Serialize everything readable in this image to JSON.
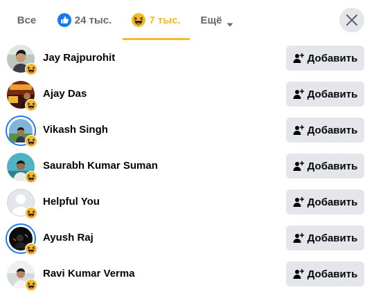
{
  "tabs": {
    "all_label": "Все",
    "like_count": "24 тыс.",
    "haha_count": "7 тыс.",
    "more_label": "Ещё"
  },
  "colors": {
    "accent_haha": "#f7b928",
    "like_blue": "#1877f2",
    "button_bg": "#e4e6eb",
    "text_primary": "#050505",
    "text_secondary": "#65676b"
  },
  "icons": {
    "like": "like-reaction-icon",
    "haha": "haha-reaction-icon",
    "more_caret": "caret-down-icon",
    "close": "close-icon",
    "add_friend": "add-friend-icon"
  },
  "people": [
    {
      "name": "Jay Rajpurohit",
      "add_label": "Добавить"
    },
    {
      "name": "Ajay Das",
      "add_label": "Добавить"
    },
    {
      "name": "Vikash Singh",
      "add_label": "Добавить"
    },
    {
      "name": "Saurabh Kumar Suman",
      "add_label": "Добавить"
    },
    {
      "name": "Helpful You",
      "add_label": "Добавить"
    },
    {
      "name": "Ayush Raj",
      "add_label": "Добавить"
    },
    {
      "name": "Ravi Kumar Verma",
      "add_label": "Добавить"
    }
  ]
}
